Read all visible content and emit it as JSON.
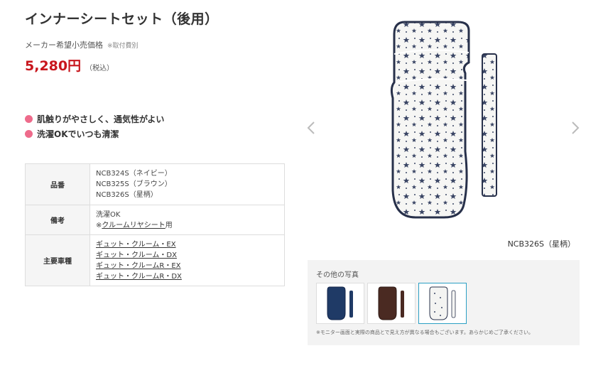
{
  "product": {
    "title": "インナーシートセット（後用）",
    "price_label": "メーカー希望小売価格",
    "price_note": "※取付費別",
    "price": "5,280円",
    "tax": "（税込）"
  },
  "features": [
    "肌触りがやさしく、通気性がよい",
    "洗濯OKでいつも清潔"
  ],
  "spec": {
    "part_number": {
      "label": "品番",
      "values": [
        "NCB324S（ネイビー）",
        "NCB325S（ブラウン）",
        "NCB326S（星柄）"
      ]
    },
    "remarks": {
      "label": "備考",
      "line1": "洗濯OK",
      "line2_prefix": "※",
      "line2_link": "クルームリヤシート",
      "line2_suffix": "用"
    },
    "vehicles": {
      "label": "主要車種",
      "values": [
        "ギュット・クルーム・EX",
        "ギュット・クルーム・DX",
        "ギュット・クルームR・EX",
        "ギュット・クルームR・DX"
      ]
    }
  },
  "viewer": {
    "caption": "NCB326S（星柄）",
    "prev_icon": "chevron-left-icon",
    "next_icon": "chevron-right-icon"
  },
  "gallery": {
    "title": "その他の写真",
    "note": "※モニター画面と実際の商品とで見え方が異なる場合もございます。あらかじめご了承ください。",
    "thumbs": [
      {
        "name": "navy",
        "color": "#1f3a66"
      },
      {
        "name": "brown",
        "color": "#4a2a22"
      },
      {
        "name": "star",
        "color": "#f4f4f2"
      }
    ]
  },
  "colors": {
    "price": "#c8161d",
    "bullet": "#ee6b8b",
    "navy_trim": "#27304a",
    "active_border": "#2b9fc4"
  }
}
